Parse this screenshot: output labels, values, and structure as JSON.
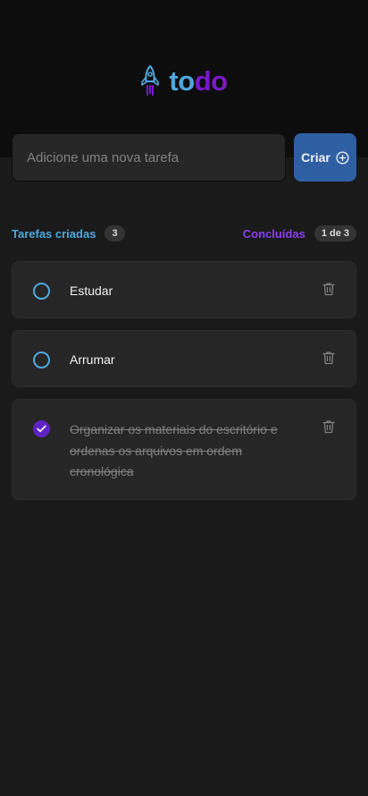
{
  "app": {
    "logo_part1": "to",
    "logo_part2": "do",
    "brand_blue": "#4ea8de",
    "brand_purple": "#7a18c9",
    "logo_icon": "rocket-icon"
  },
  "new_task": {
    "placeholder": "Adicione uma nova tarefa",
    "value": "",
    "create_label": "Criar",
    "create_icon": "plus-circle-icon"
  },
  "summary": {
    "created_label": "Tarefas criadas",
    "created_count": "3",
    "done_label": "Concluídas",
    "done_count": "1 de 3"
  },
  "tasks": [
    {
      "text": "Estudar",
      "done": false
    },
    {
      "text": "Arrumar",
      "done": false
    },
    {
      "text": "Organizar os materiais do escritório e ordenas os arquivos em ordem cronológica",
      "done": true
    }
  ],
  "icons": {
    "delete": "trash-icon",
    "check": "checkmark-icon"
  }
}
